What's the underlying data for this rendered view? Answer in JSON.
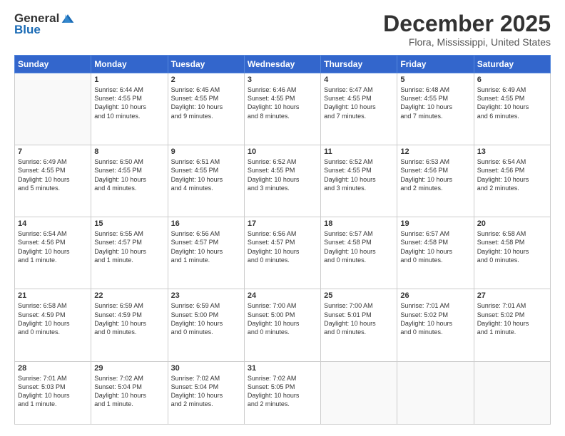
{
  "logo": {
    "general": "General",
    "blue": "Blue"
  },
  "header": {
    "title": "December 2025",
    "subtitle": "Flora, Mississippi, United States"
  },
  "days_of_week": [
    "Sunday",
    "Monday",
    "Tuesday",
    "Wednesday",
    "Thursday",
    "Friday",
    "Saturday"
  ],
  "weeks": [
    [
      {
        "day": "",
        "info": ""
      },
      {
        "day": "1",
        "info": "Sunrise: 6:44 AM\nSunset: 4:55 PM\nDaylight: 10 hours\nand 10 minutes."
      },
      {
        "day": "2",
        "info": "Sunrise: 6:45 AM\nSunset: 4:55 PM\nDaylight: 10 hours\nand 9 minutes."
      },
      {
        "day": "3",
        "info": "Sunrise: 6:46 AM\nSunset: 4:55 PM\nDaylight: 10 hours\nand 8 minutes."
      },
      {
        "day": "4",
        "info": "Sunrise: 6:47 AM\nSunset: 4:55 PM\nDaylight: 10 hours\nand 7 minutes."
      },
      {
        "day": "5",
        "info": "Sunrise: 6:48 AM\nSunset: 4:55 PM\nDaylight: 10 hours\nand 7 minutes."
      },
      {
        "day": "6",
        "info": "Sunrise: 6:49 AM\nSunset: 4:55 PM\nDaylight: 10 hours\nand 6 minutes."
      }
    ],
    [
      {
        "day": "7",
        "info": "Sunrise: 6:49 AM\nSunset: 4:55 PM\nDaylight: 10 hours\nand 5 minutes."
      },
      {
        "day": "8",
        "info": "Sunrise: 6:50 AM\nSunset: 4:55 PM\nDaylight: 10 hours\nand 4 minutes."
      },
      {
        "day": "9",
        "info": "Sunrise: 6:51 AM\nSunset: 4:55 PM\nDaylight: 10 hours\nand 4 minutes."
      },
      {
        "day": "10",
        "info": "Sunrise: 6:52 AM\nSunset: 4:55 PM\nDaylight: 10 hours\nand 3 minutes."
      },
      {
        "day": "11",
        "info": "Sunrise: 6:52 AM\nSunset: 4:55 PM\nDaylight: 10 hours\nand 3 minutes."
      },
      {
        "day": "12",
        "info": "Sunrise: 6:53 AM\nSunset: 4:56 PM\nDaylight: 10 hours\nand 2 minutes."
      },
      {
        "day": "13",
        "info": "Sunrise: 6:54 AM\nSunset: 4:56 PM\nDaylight: 10 hours\nand 2 minutes."
      }
    ],
    [
      {
        "day": "14",
        "info": "Sunrise: 6:54 AM\nSunset: 4:56 PM\nDaylight: 10 hours\nand 1 minute."
      },
      {
        "day": "15",
        "info": "Sunrise: 6:55 AM\nSunset: 4:57 PM\nDaylight: 10 hours\nand 1 minute."
      },
      {
        "day": "16",
        "info": "Sunrise: 6:56 AM\nSunset: 4:57 PM\nDaylight: 10 hours\nand 1 minute."
      },
      {
        "day": "17",
        "info": "Sunrise: 6:56 AM\nSunset: 4:57 PM\nDaylight: 10 hours\nand 0 minutes."
      },
      {
        "day": "18",
        "info": "Sunrise: 6:57 AM\nSunset: 4:58 PM\nDaylight: 10 hours\nand 0 minutes."
      },
      {
        "day": "19",
        "info": "Sunrise: 6:57 AM\nSunset: 4:58 PM\nDaylight: 10 hours\nand 0 minutes."
      },
      {
        "day": "20",
        "info": "Sunrise: 6:58 AM\nSunset: 4:58 PM\nDaylight: 10 hours\nand 0 minutes."
      }
    ],
    [
      {
        "day": "21",
        "info": "Sunrise: 6:58 AM\nSunset: 4:59 PM\nDaylight: 10 hours\nand 0 minutes."
      },
      {
        "day": "22",
        "info": "Sunrise: 6:59 AM\nSunset: 4:59 PM\nDaylight: 10 hours\nand 0 minutes."
      },
      {
        "day": "23",
        "info": "Sunrise: 6:59 AM\nSunset: 5:00 PM\nDaylight: 10 hours\nand 0 minutes."
      },
      {
        "day": "24",
        "info": "Sunrise: 7:00 AM\nSunset: 5:00 PM\nDaylight: 10 hours\nand 0 minutes."
      },
      {
        "day": "25",
        "info": "Sunrise: 7:00 AM\nSunset: 5:01 PM\nDaylight: 10 hours\nand 0 minutes."
      },
      {
        "day": "26",
        "info": "Sunrise: 7:01 AM\nSunset: 5:02 PM\nDaylight: 10 hours\nand 0 minutes."
      },
      {
        "day": "27",
        "info": "Sunrise: 7:01 AM\nSunset: 5:02 PM\nDaylight: 10 hours\nand 1 minute."
      }
    ],
    [
      {
        "day": "28",
        "info": "Sunrise: 7:01 AM\nSunset: 5:03 PM\nDaylight: 10 hours\nand 1 minute."
      },
      {
        "day": "29",
        "info": "Sunrise: 7:02 AM\nSunset: 5:04 PM\nDaylight: 10 hours\nand 1 minute."
      },
      {
        "day": "30",
        "info": "Sunrise: 7:02 AM\nSunset: 5:04 PM\nDaylight: 10 hours\nand 2 minutes."
      },
      {
        "day": "31",
        "info": "Sunrise: 7:02 AM\nSunset: 5:05 PM\nDaylight: 10 hours\nand 2 minutes."
      },
      {
        "day": "",
        "info": ""
      },
      {
        "day": "",
        "info": ""
      },
      {
        "day": "",
        "info": ""
      }
    ]
  ]
}
